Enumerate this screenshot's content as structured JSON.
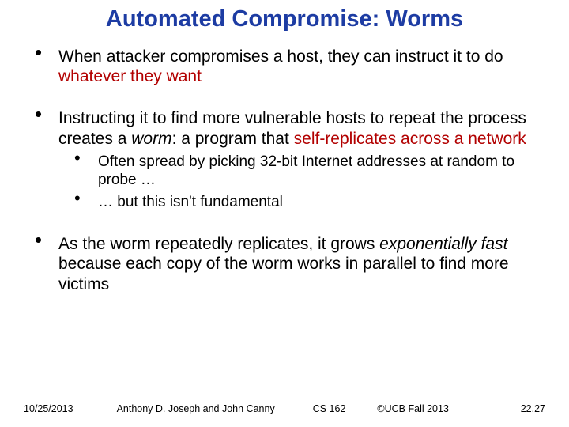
{
  "title": "Automated Compromise: Worms",
  "bullets": {
    "b1": {
      "t1": "When attacker compromises a host, they can instruct it to do ",
      "r1": "whatever they want"
    },
    "b2": {
      "t1": "Instructing it to find more vulnerable hosts to repeat the process creates a ",
      "i1": "worm",
      "t2": ": a program that ",
      "r1": "self-replicates ",
      "r2": "across a network",
      "sub1": "Often spread by picking 32-bit Internet addresses at random to probe …",
      "sub2": "… but this isn't fundamental"
    },
    "b3": {
      "t1": "As the worm repeatedly replicates, it grows ",
      "i1": "exponentially fast",
      "t2": " because each copy of the worm works in parallel to find more victims"
    }
  },
  "footer": {
    "date": "10/25/2013",
    "authors": "Anthony D. Joseph and John Canny",
    "course": "CS 162",
    "copyright": "©UCB Fall 2013",
    "page": "22.27"
  }
}
